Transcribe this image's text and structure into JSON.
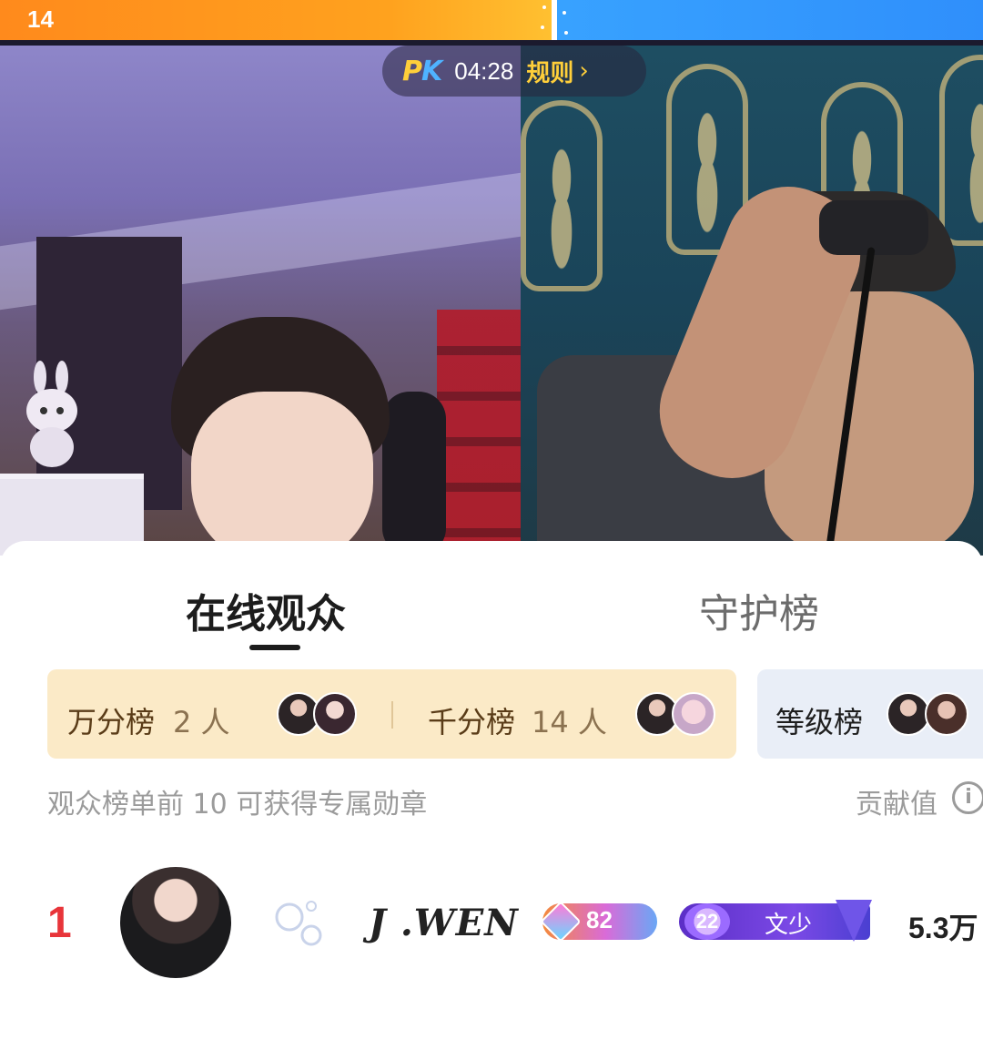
{
  "pk": {
    "left_score": "14",
    "logo_p": "P",
    "logo_k": "K",
    "timer": "04:28",
    "rules_label": "规则",
    "rules_chevron": "›",
    "left_color": "#ff8a1c",
    "right_color": "#2f8ffb"
  },
  "tabs": {
    "online": "在线观众",
    "guard": "守护榜"
  },
  "boards": {
    "wan_label": "万分榜",
    "wan_count": "2 人",
    "qian_label": "千分榜",
    "qian_count": "14 人",
    "level_label": "等级榜"
  },
  "hint": "观众榜单前 10 可获得专属勋章",
  "contribution_label": "贡献值",
  "info_icon": "i",
  "rows": [
    {
      "rank": "1",
      "name": "J .WEN",
      "level": "82",
      "fan_level": "22",
      "fan_name": "文少",
      "score": "5.3万"
    }
  ],
  "colors": {
    "rank_red": "#e8353a",
    "board_card": "#fbeac7",
    "pk_gold": "#ffcf3a"
  }
}
